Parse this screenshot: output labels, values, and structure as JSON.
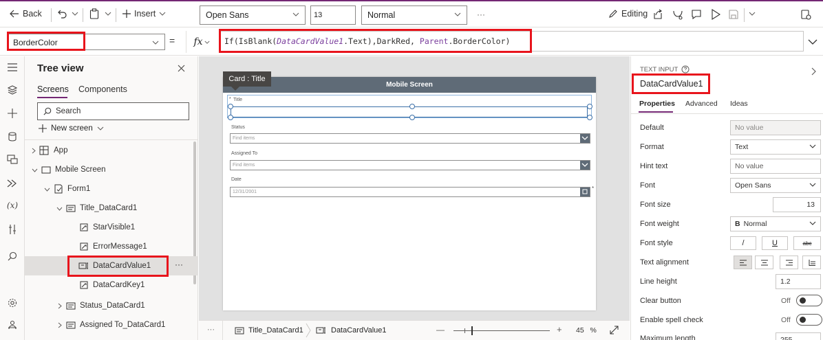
{
  "toolbar": {
    "back_label": "Back",
    "insert_label": "Insert",
    "font_family": "Open Sans",
    "font_size": "13",
    "font_weight": "Normal",
    "more_label": "···",
    "editing_label": "Editing"
  },
  "formula": {
    "property": "BorderColor",
    "equals": "=",
    "fx_label": "fx",
    "parts": {
      "if_open": "If(",
      "isblank": "IsBlank(",
      "control": "DataCardValue1",
      "text_close": ".Text),DarkRed, ",
      "parent": "Parent",
      "border_close": ".BorderColor)"
    }
  },
  "tree": {
    "title": "Tree view",
    "tabs": [
      "Screens",
      "Components"
    ],
    "search_placeholder": "Search",
    "new_screen_label": "New screen",
    "items": [
      {
        "label": "App"
      },
      {
        "label": "Mobile Screen"
      },
      {
        "label": "Form1"
      },
      {
        "label": "Title_DataCard1"
      },
      {
        "label": "StarVisible1"
      },
      {
        "label": "ErrorMessage1"
      },
      {
        "label": "DataCardValue1"
      },
      {
        "label": "DataCardKey1"
      },
      {
        "label": "Status_DataCard1"
      },
      {
        "label": "Assigned To_DataCard1"
      }
    ],
    "row_more": "···"
  },
  "canvas": {
    "tooltip": "Card : Title",
    "screen_title": "Mobile Screen",
    "fields": [
      {
        "label": "Title",
        "star": "*",
        "value": ""
      },
      {
        "label": "Status",
        "value": "Find items"
      },
      {
        "label": "Assigned To",
        "value": "Find items"
      },
      {
        "label": "Date",
        "value": "12/31/2001"
      }
    ],
    "date_star": "*"
  },
  "statusbar": {
    "more": "···",
    "crumb1": "Title_DataCard1",
    "crumb2": "DataCardValue1",
    "minus": "—",
    "plus": "+",
    "zoom": "45",
    "zoom_unit": "%",
    "zoom_level": 0.45
  },
  "props": {
    "type_label": "TEXT INPUT",
    "control_name": "DataCardValue1",
    "tabs": [
      "Properties",
      "Advanced",
      "Ideas"
    ],
    "rows": {
      "default": {
        "label": "Default",
        "value": "No value"
      },
      "format": {
        "label": "Format",
        "value": "Text"
      },
      "hint": {
        "label": "Hint text",
        "value": "No value"
      },
      "font": {
        "label": "Font",
        "value": "Open Sans"
      },
      "font_size": {
        "label": "Font size",
        "value": "13"
      },
      "font_weight": {
        "label": "Font weight",
        "value": "Normal",
        "icon_text": "B"
      },
      "font_style": {
        "label": "Font style",
        "italic": "/",
        "underline": "U",
        "strike": "abc"
      },
      "text_alignment": {
        "label": "Text alignment"
      },
      "line_height": {
        "label": "Line height",
        "value": "1.2"
      },
      "clear_button": {
        "label": "Clear button",
        "value": "Off"
      },
      "spell_check": {
        "label": "Enable spell check",
        "value": "Off"
      },
      "max_length": {
        "label": "Maximum length",
        "value": "255"
      }
    }
  },
  "colors": {
    "accent": "#742774",
    "highlight": "#e8141c",
    "screen_header": "#5f6b77",
    "dark_red": "#8b0000"
  }
}
